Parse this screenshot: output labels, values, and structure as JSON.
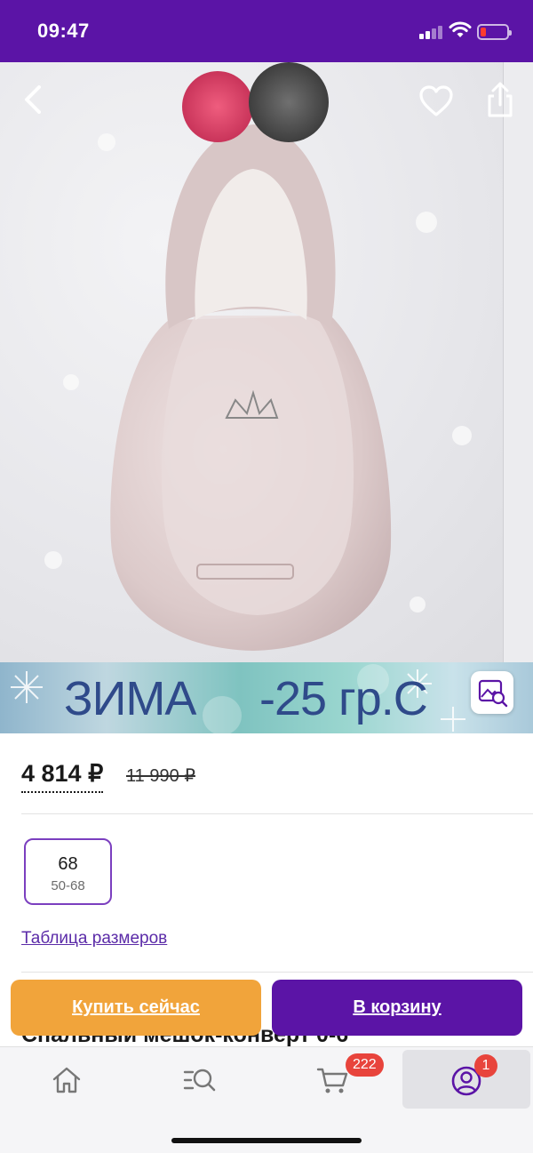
{
  "status_bar": {
    "time": "09:47",
    "signal_icon": "cellular-signal-icon",
    "wifi_icon": "wifi-icon",
    "battery_icon": "battery-low-icon",
    "battery_color": "#ff3b30"
  },
  "product_image": {
    "back_icon": "chevron-left-icon",
    "favorite_icon": "heart-outline-icon",
    "share_icon": "share-icon",
    "visual_search_icon": "image-search-icon"
  },
  "banner": {
    "left_text": "ЗИМА",
    "right_text": "-25 гр.С"
  },
  "price": {
    "current": "4 814 ₽",
    "old": "11 990 ₽"
  },
  "sizes": [
    {
      "size": "68",
      "range": "50-68",
      "selected": true
    }
  ],
  "size_table_link": "Таблица размеров",
  "product_title": "Спальный мешок-конверт 0-6",
  "actions": {
    "buy_now": "Купить сейчас",
    "add_to_cart": "В корзину"
  },
  "tab_bar": {
    "tabs": [
      {
        "name": "home",
        "icon": "home-icon"
      },
      {
        "name": "catalog",
        "icon": "catalog-search-icon"
      },
      {
        "name": "cart",
        "icon": "cart-icon",
        "badge": "222"
      },
      {
        "name": "profile",
        "icon": "profile-icon",
        "badge": "1",
        "active": true
      }
    ]
  },
  "colors": {
    "brand_purple": "#5b14a6",
    "buy_orange": "#f1a43b",
    "badge_red": "#e8443c"
  }
}
